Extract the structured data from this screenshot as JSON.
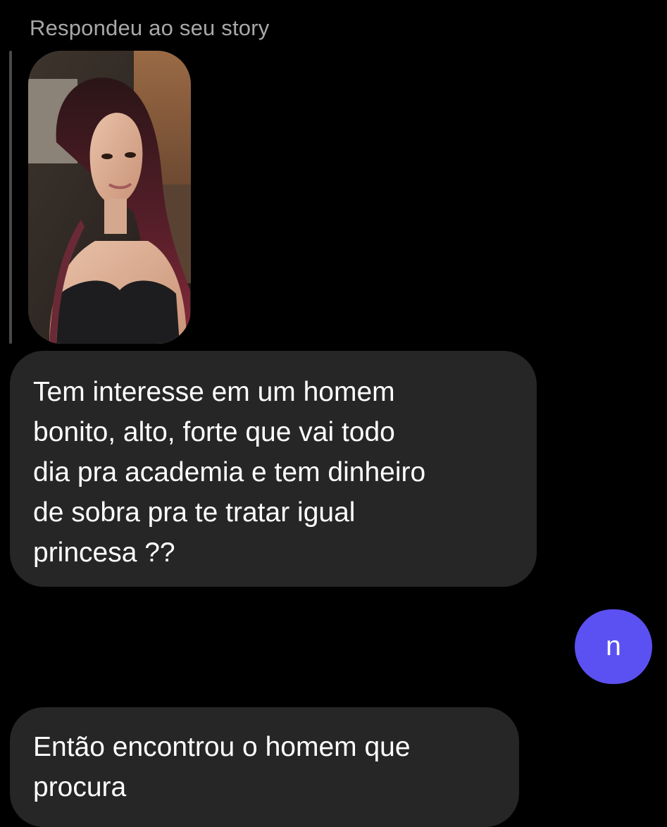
{
  "reply_context": {
    "label": "Respondeu ao seu story",
    "story_image": "story-photo-thumbnail"
  },
  "messages": [
    {
      "direction": "incoming",
      "lines": [
        "Tem interesse em um homem",
        "bonito, alto, forte que vai todo",
        "dia pra academia e tem dinheiro",
        "de sobra pra te tratar igual",
        "princesa ??"
      ]
    },
    {
      "direction": "outgoing",
      "text": "n"
    },
    {
      "direction": "incoming",
      "lines": [
        "Então encontrou o homem que",
        "procura"
      ]
    }
  ],
  "colors": {
    "background": "#000000",
    "incoming_bubble": "#262626",
    "outgoing_bubble": "#5b51f2",
    "reply_label": "#a8a8a8"
  }
}
